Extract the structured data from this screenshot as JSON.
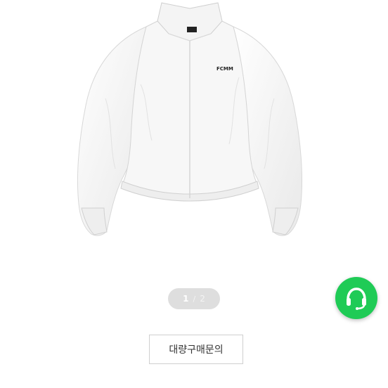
{
  "product": {
    "image_icon": "white-cropped-track-jacket",
    "logo_text": "FCMM"
  },
  "gallery": {
    "current": "1",
    "separator": "/",
    "total": "2"
  },
  "chat_button": {
    "icon": "headset-chat-icon",
    "color": "#1fcb56"
  },
  "bulk_inquiry": {
    "label": "대량구매문의"
  }
}
